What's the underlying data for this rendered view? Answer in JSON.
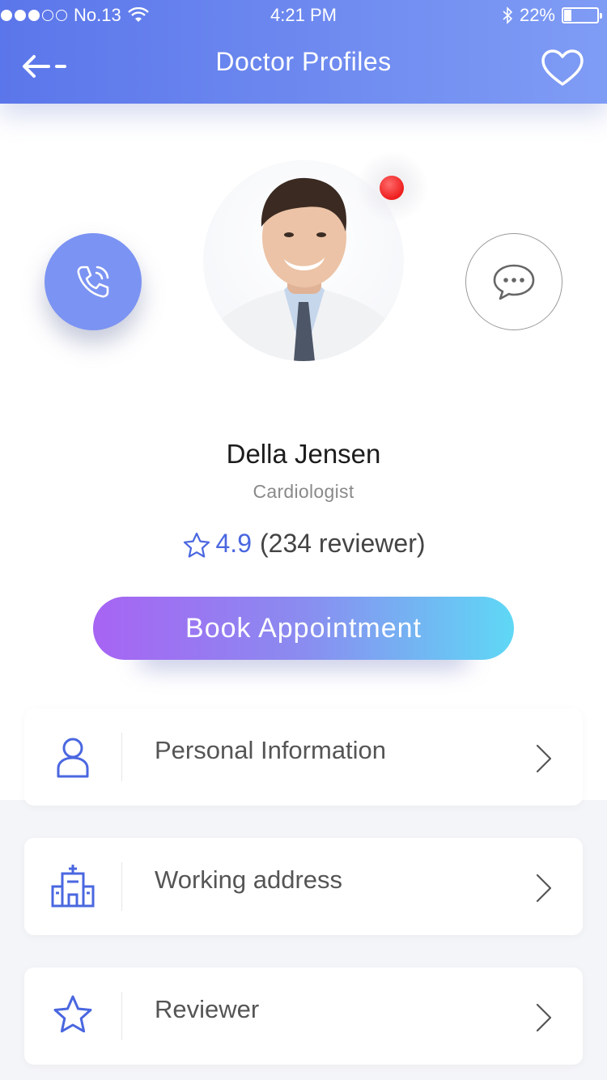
{
  "status_bar": {
    "carrier": "No.13",
    "time": "4:21 PM",
    "battery": "22%",
    "battery_level": 0.22
  },
  "nav": {
    "title": "Doctor Profiles",
    "back_icon": "arrow-left-icon",
    "favorite_icon": "heart-icon"
  },
  "profile": {
    "name": "Della Jensen",
    "specialty": "Cardiologist",
    "rating": "4.9",
    "reviews": "(234 reviewer)",
    "online": true
  },
  "actions": {
    "book_label": "Book Appointment"
  },
  "menu": [
    {
      "label": "Personal Information",
      "icon": "person-icon"
    },
    {
      "label": "Working address",
      "icon": "hospital-icon"
    },
    {
      "label": "Reviewer",
      "icon": "star-icon"
    }
  ],
  "colors": {
    "header_start": "#5b76ea",
    "header_end": "#7f9cf5",
    "accent": "#4a67e0",
    "button_start": "#a764f3",
    "button_end": "#5fd8f5",
    "online": "#ee1d1d"
  }
}
